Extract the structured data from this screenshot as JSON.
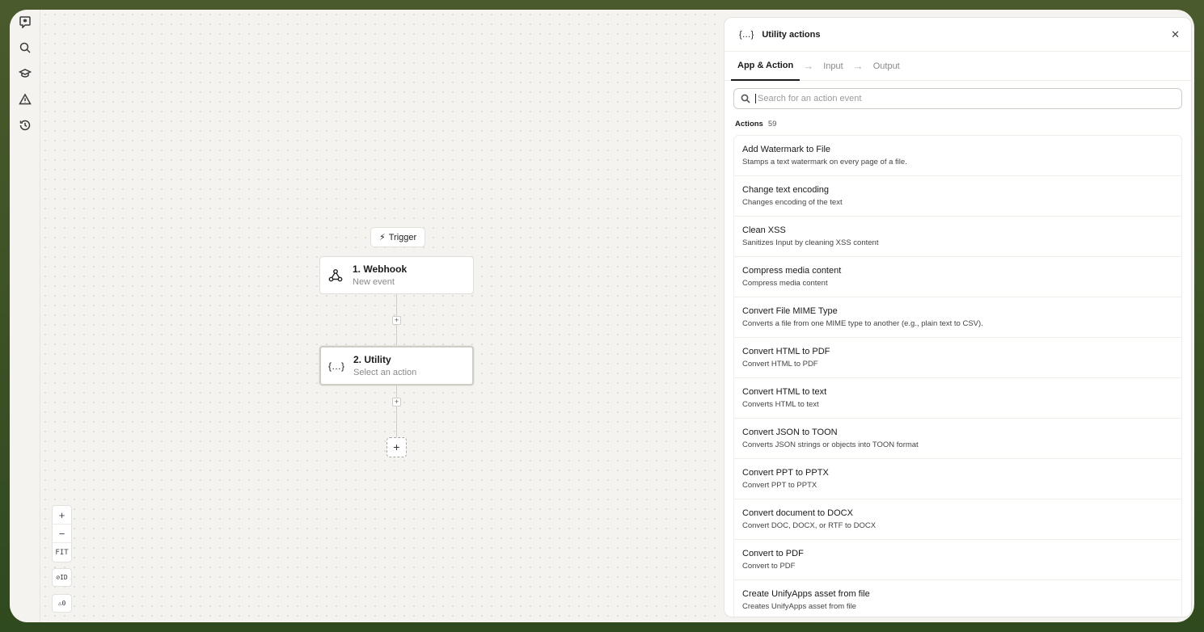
{
  "canvas": {
    "trigger_chip": "Trigger",
    "nodes": [
      {
        "title": "1. Webhook",
        "subtitle": "New event"
      },
      {
        "title": "2. Utility",
        "subtitle": "Select an action"
      }
    ],
    "zoom_in": "+",
    "zoom_out": "−",
    "fit": "FIT",
    "id_toggle": "ID",
    "warnings_count": "0"
  },
  "panel": {
    "title": "Utility actions",
    "icon": "{…}",
    "tabs": [
      {
        "label": "App & Action",
        "active": true
      },
      {
        "label": "Input",
        "active": false
      },
      {
        "label": "Output",
        "active": false
      }
    ],
    "search": {
      "placeholder": "Search for an action event",
      "value": ""
    },
    "actions_label": "Actions",
    "actions_count": "59",
    "items": [
      {
        "title": "Add Watermark to File",
        "desc": "Stamps a text watermark on every page of a file."
      },
      {
        "title": "Change text encoding",
        "desc": "Changes encoding of the text"
      },
      {
        "title": "Clean XSS",
        "desc": "Sanitizes Input by cleaning XSS content"
      },
      {
        "title": "Compress media content",
        "desc": "Compress media content"
      },
      {
        "title": "Convert File MIME Type",
        "desc": "Converts a file from one MIME type to another (e.g., plain text to CSV)."
      },
      {
        "title": "Convert HTML to PDF",
        "desc": "Convert HTML to PDF"
      },
      {
        "title": "Convert HTML to text",
        "desc": "Converts HTML to text"
      },
      {
        "title": "Convert JSON to TOON",
        "desc": "Converts JSON strings or objects into TOON format"
      },
      {
        "title": "Convert PPT to PPTX",
        "desc": "Convert PPT to PPTX"
      },
      {
        "title": "Convert document to DOCX",
        "desc": "Convert DOC, DOCX, or RTF to DOCX"
      },
      {
        "title": "Convert to PDF",
        "desc": "Convert to PDF"
      },
      {
        "title": "Create UnifyApps asset from file",
        "desc": "Creates UnifyApps asset from file"
      }
    ]
  },
  "colors": {
    "frame_bg": "#f4f3f0",
    "outer_bg": "#3f5226",
    "accent": "#1a1a1a"
  }
}
